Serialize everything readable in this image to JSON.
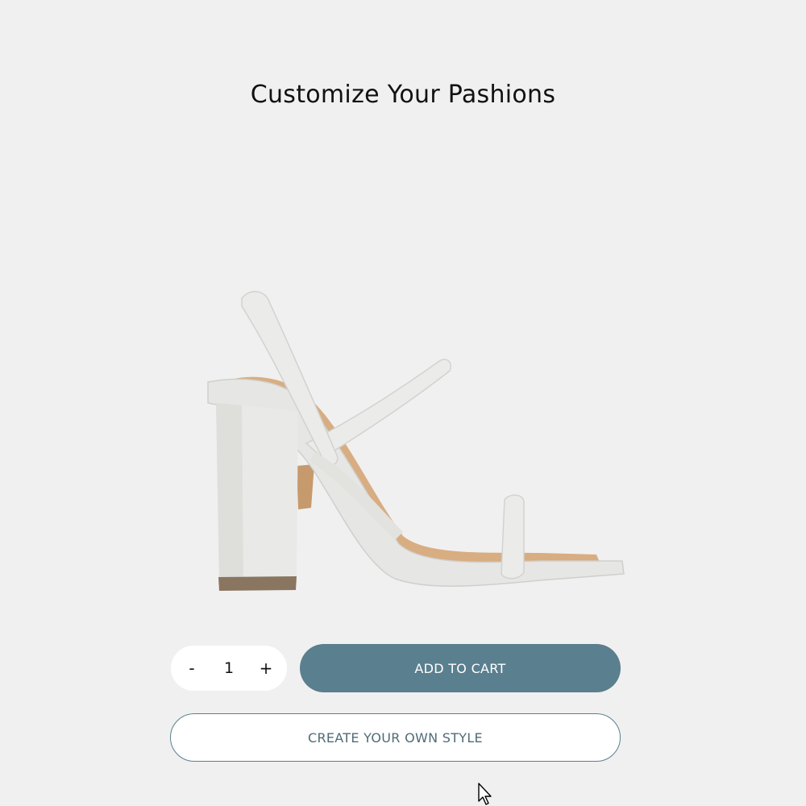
{
  "page": {
    "title": "Customize Your Pashions"
  },
  "product": {
    "image_icon": "strappy-block-heel-sandal",
    "colors": {
      "upper": "#ececea",
      "lining": "#d8ad82",
      "heel_tip": "#8a7560"
    }
  },
  "quantity": {
    "decrement_label": "-",
    "value": "1",
    "increment_label": "+"
  },
  "actions": {
    "add_to_cart_label": "ADD TO CART",
    "create_style_label": "CREATE YOUR OWN STYLE"
  },
  "colors": {
    "background": "#f0f0f0",
    "accent": "#5a7f8e"
  }
}
